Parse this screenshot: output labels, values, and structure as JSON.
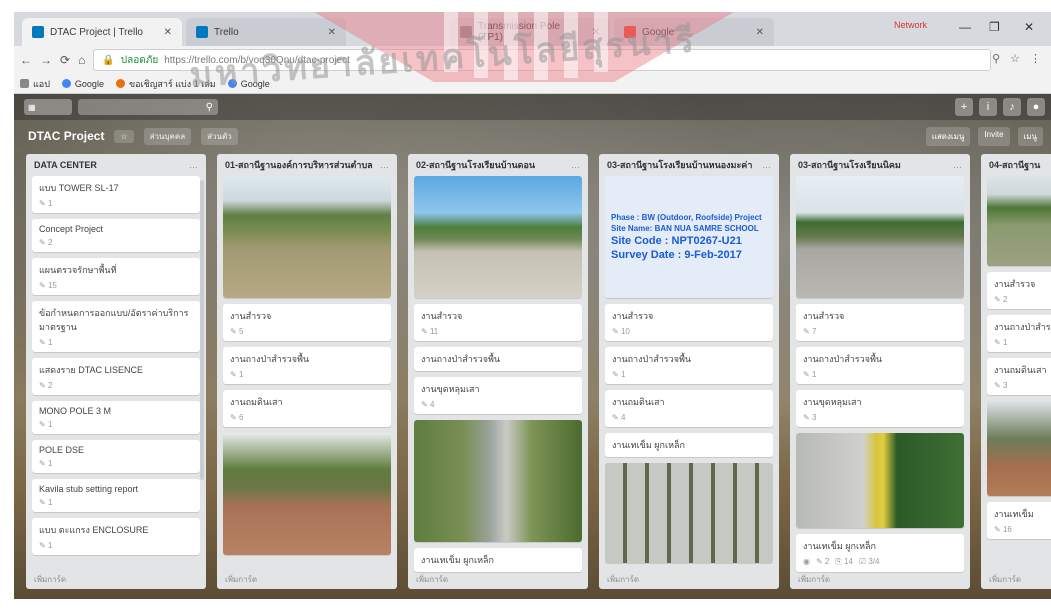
{
  "browser": {
    "tabs": [
      {
        "label": "DTAC Project | Trello",
        "active": true
      },
      {
        "label": "Trello",
        "active": false
      },
      {
        "label": "Transmission Pole (TP1)",
        "active": false
      },
      {
        "label": "Google",
        "active": false
      }
    ],
    "user": "Network",
    "address": {
      "secure_label": "ปลอดภัย",
      "url": "https://trello.com/b/voq30Qnu/dtac-project"
    },
    "bookmarks": [
      "แอป",
      "Google",
      "ขอเชิญสาร์ แบ่ง 1 เล่ม",
      "Google"
    ]
  },
  "board": {
    "title": "DTAC Project",
    "chips": [
      "ส่วนบุคคล",
      "ส่วนตัว"
    ],
    "header_right": [
      "แสดงเมนู",
      "Invite",
      "เมนู"
    ],
    "lists": [
      {
        "title": "DATA CENTER",
        "cards": [
          {
            "title": "แบบ TOWER SL-17",
            "meta": "1"
          },
          {
            "title": "Concept Project",
            "meta": "2"
          },
          {
            "title": "แผนตรวจรักษาพื้นที่",
            "meta": "15"
          },
          {
            "title": "ข้อกำหนดการออกแบบ/อัตราค่าบริการมาตรฐาน",
            "meta": "1"
          },
          {
            "title": "แสดงราย DTAC LISENCE",
            "meta": "2"
          },
          {
            "title": "MONO POLE 3 M",
            "meta": "1"
          },
          {
            "title": "POLE DSE",
            "meta": "1"
          },
          {
            "title": "Kavila stub setting report",
            "meta": "1"
          },
          {
            "title": "แบบ ตะแกรง ENCLOSURE",
            "meta": "1"
          }
        ],
        "add_label": "เพิ่มการ์ด"
      },
      {
        "title": "01-สถานีฐานองค์การบริหารส่วนตำบล",
        "cards": [
          {
            "cover": "ph-field"
          },
          {
            "title": "งานสำรวจ",
            "meta": "5"
          },
          {
            "title": "งานถางป่าสำรวจพื้น",
            "meta": "1"
          },
          {
            "title": "งานถมดินเสา",
            "meta": "6"
          },
          {
            "cover": "ph-dirt"
          }
        ],
        "add_label": "เพิ่มการ์ด"
      },
      {
        "title": "02-สถานีฐานโรงเรียนบ้านดอน",
        "cards": [
          {
            "cover": "ph-road"
          },
          {
            "title": "งานสำรวจ",
            "meta": "11"
          },
          {
            "title": "งานถางป่าสำรวจพื้น",
            "meta": ""
          },
          {
            "title": "งานขุดหลุมเสา",
            "meta": "4"
          },
          {
            "cover": "ph-pole"
          },
          {
            "title": "งานเทเข็ม ผูกเหล็ก",
            "meta": ""
          }
        ],
        "add_label": "เพิ่มการ์ด"
      },
      {
        "title": "03-สถานีฐานโรงเรียนบ้านหนองมะค่า",
        "cards": [
          {
            "sign": [
              "Phase : BW (Outdoor, Roofside) Project",
              "Site Name: BAN NUA SAMRE SCHOOL",
              "Site Code : NPT0267-U21",
              "Survey Date : 9-Feb-2017"
            ]
          },
          {
            "title": "งานสำรวจ",
            "meta": "10"
          },
          {
            "title": "งานถางป่าสำรวจพื้น",
            "meta": "1"
          },
          {
            "title": "งานถมดินเสา",
            "meta": "4"
          },
          {
            "title": "งานเทเข็ม ผูกเหล็ก",
            "meta": ""
          },
          {
            "cover": "ph-rebar"
          }
        ],
        "add_label": "เพิ่มการ์ด"
      },
      {
        "title": "03-สถานีฐานโรงเรียนนิคม",
        "cards": [
          {
            "cover": "ph-road2"
          },
          {
            "title": "งานสำรวจ",
            "meta": "7"
          },
          {
            "title": "งานถางป่าสำรวจพื้น",
            "meta": "1"
          },
          {
            "title": "งานขุดหลุมเสา",
            "meta": "3"
          },
          {
            "cover": "ph-rebar2"
          },
          {
            "title": "งานเทเข็ม ผูกเหล็ก",
            "badges": [
              "2",
              "14",
              "3/4"
            ]
          }
        ],
        "add_label": "เพิ่มการ์ด"
      },
      {
        "title": "04-สถานีฐาน",
        "cards": [
          {
            "cover": "ph-partial"
          },
          {
            "title": "งานสำรวจ",
            "meta": "2"
          },
          {
            "title": "งานถางป่าสำรวจ",
            "meta": "1"
          },
          {
            "title": "งานถมดินเสา",
            "meta": "3"
          },
          {
            "cover": "ph-partial2"
          },
          {
            "title": "งานเทเข็ม",
            "meta": "16"
          }
        ],
        "add_label": "เพิ่มการ์ด"
      }
    ]
  },
  "watermark": {
    "text": "มหาวิทยาลัยเทคโนโลยีสุรนารี"
  }
}
